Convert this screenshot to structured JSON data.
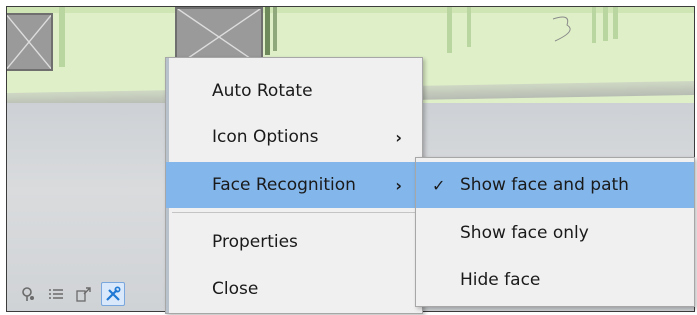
{
  "toolbar": {
    "buttons": [
      {
        "icon": "map-pin-icon"
      },
      {
        "icon": "list-icon"
      },
      {
        "icon": "export-icon"
      },
      {
        "icon": "tools-icon",
        "active": true
      }
    ]
  },
  "context_menu": {
    "items": [
      {
        "label": "Auto Rotate",
        "has_submenu": false,
        "highlighted": false
      },
      {
        "label": "Icon Options",
        "has_submenu": true,
        "highlighted": false
      },
      {
        "label": "Face Recognition",
        "has_submenu": true,
        "highlighted": true
      },
      {
        "label": "Properties",
        "has_submenu": false,
        "highlighted": false
      },
      {
        "label": "Close",
        "has_submenu": false,
        "highlighted": false
      }
    ],
    "submenu_arrow": "›"
  },
  "submenu": {
    "check_glyph": "✓",
    "items": [
      {
        "label": "Show face and path",
        "checked": true,
        "highlighted": true
      },
      {
        "label": "Show face only",
        "checked": false,
        "highlighted": false
      },
      {
        "label": "Hide face",
        "checked": false,
        "highlighted": false
      }
    ]
  },
  "colors": {
    "highlight": "#83b6ea",
    "menu_background": "#f0f0f0",
    "map_green": "#dff0c8",
    "active_tool": "#1e78d4"
  }
}
